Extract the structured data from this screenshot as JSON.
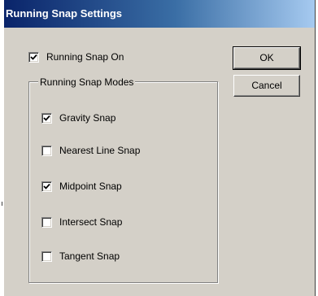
{
  "dialog": {
    "title": "Running Snap Settings",
    "running_snap": {
      "label": "Running Snap On",
      "checked": true
    },
    "ok_label": "OK",
    "cancel_label": "Cancel",
    "modes_group": {
      "label": "Running Snap Modes",
      "items": [
        {
          "label": "Gravity Snap",
          "checked": true
        },
        {
          "label": "Nearest Line Snap",
          "checked": false
        },
        {
          "label": "Midpoint Snap",
          "checked": true
        },
        {
          "label": "Intersect Snap",
          "checked": false
        },
        {
          "label": "Tangent Snap",
          "checked": false
        }
      ]
    }
  }
}
